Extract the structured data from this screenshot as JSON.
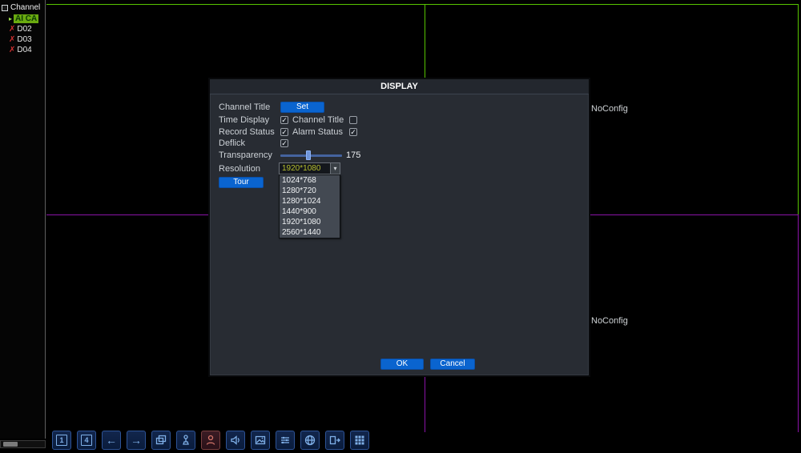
{
  "sidebar": {
    "root_label": "Channel",
    "play_glyph": "▸",
    "offline_glyph": "✗",
    "items": [
      {
        "label": "AI CA",
        "selected": true
      },
      {
        "label": "D02",
        "selected": false
      },
      {
        "label": "D03",
        "selected": false
      },
      {
        "label": "D04",
        "selected": false
      }
    ]
  },
  "video": {
    "noconfig_top_right": "NoConfig",
    "noconfig_bottom_right": "NoConfig"
  },
  "dialog": {
    "title": "DISPLAY",
    "channel_title_label": "Channel Title",
    "set_button": "Set",
    "time_display_label": "Time Display",
    "channel_title_cb_label": "Channel Title",
    "record_status_label": "Record Status",
    "alarm_status_label": "Alarm Status",
    "deflick_label": "Deflick",
    "transparency_label": "Transparency",
    "transparency_value": "175",
    "resolution_label": "Resolution",
    "resolution_value": "1920*1080",
    "dropdown_arrow": "▾",
    "resolution_options": [
      "1024*768",
      "1280*720",
      "1280*1024",
      "1440*900",
      "1920*1080",
      "2560*1440"
    ],
    "tour_button": "Tour",
    "ok_button": "OK",
    "cancel_button": "Cancel",
    "checkboxes": {
      "time_display": true,
      "channel_title": false,
      "record_status": true,
      "alarm_status": true,
      "deflick": true
    }
  },
  "toolbar": {
    "screen1_label": "1",
    "screen4_label": "4",
    "prev_glyph": "←",
    "next_glyph": "→",
    "icons": [
      "single-screen",
      "quad-screen",
      "previous-channel",
      "next-channel",
      "tour",
      "ptz-control",
      "user",
      "voice",
      "image-color",
      "output-adjust",
      "network",
      "logout",
      "channel-grid"
    ]
  },
  "colors": {
    "accent_blue": "#0a64cf",
    "active_pane_border": "#57c400",
    "pane_divider_purple": "#8a13a8",
    "selected_channel_bg": "#6aaa10",
    "offline_x_red": "#d03030",
    "resolution_value_text": "#b7bf2e"
  }
}
